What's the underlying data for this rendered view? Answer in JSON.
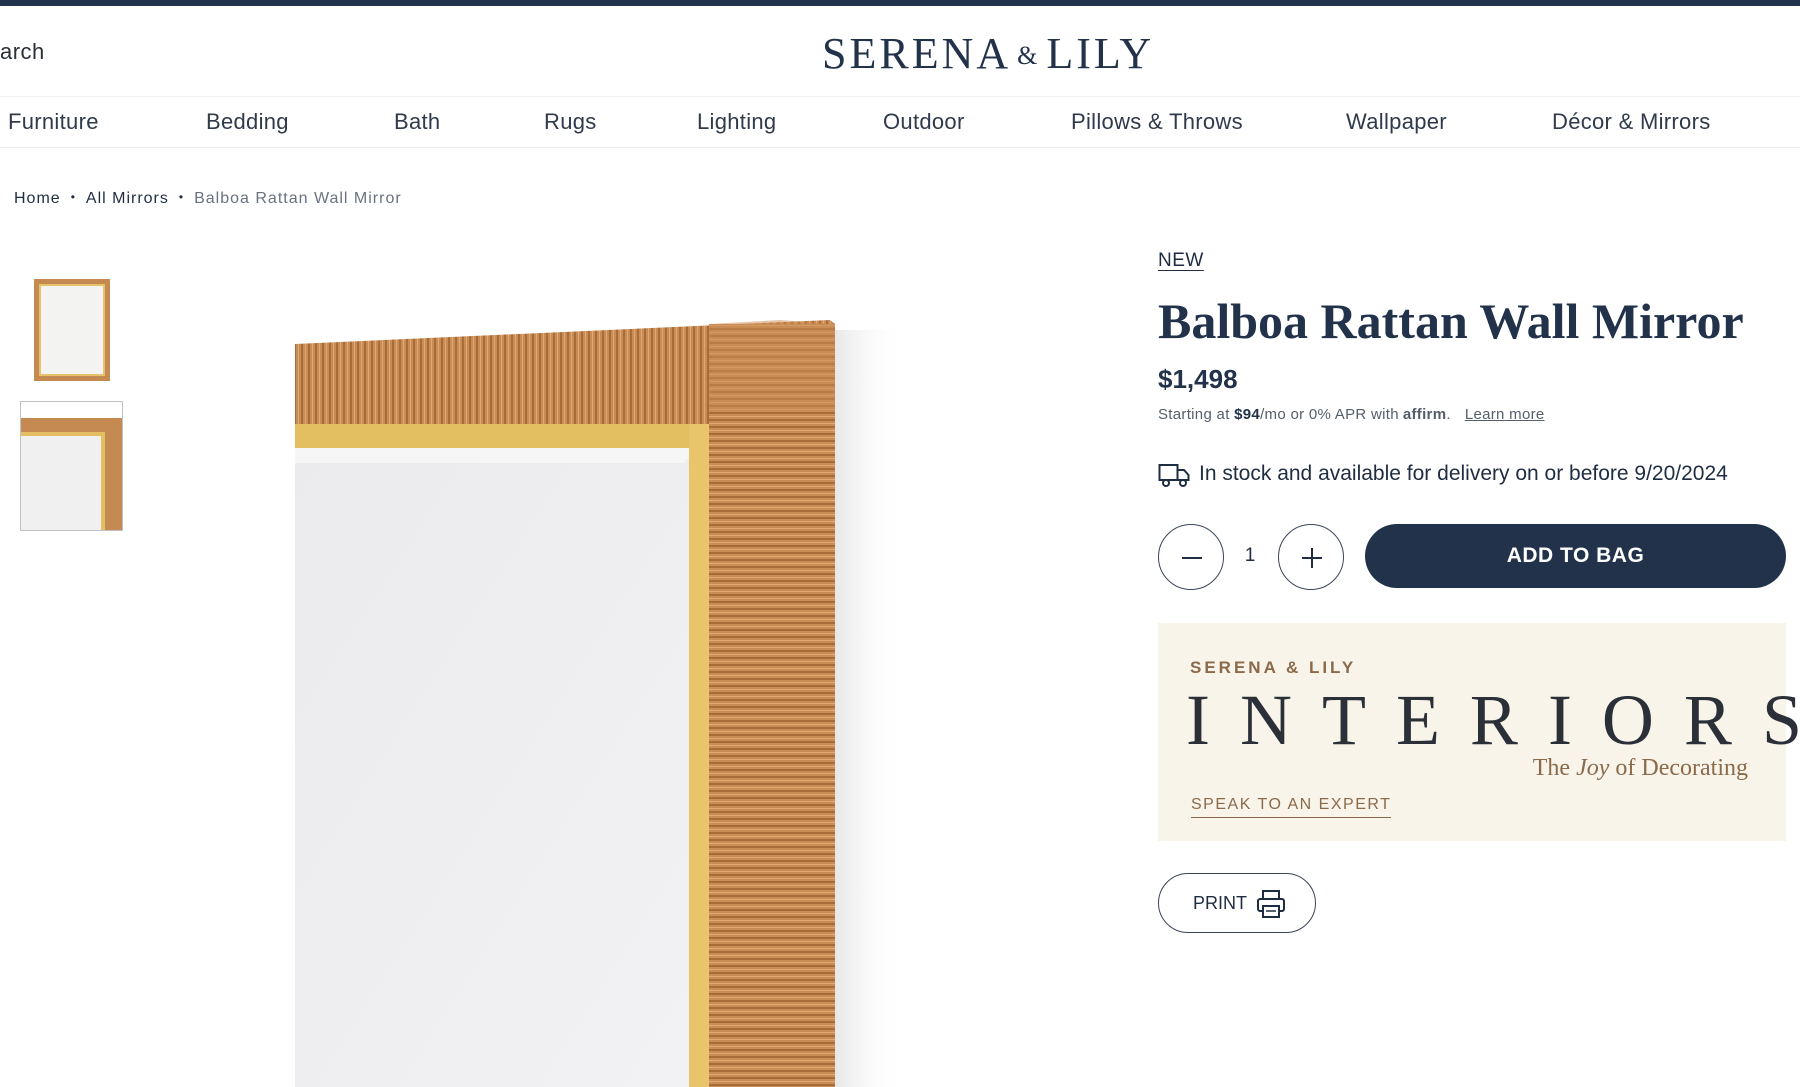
{
  "header": {
    "search_text": "arch",
    "logo": {
      "left": "SERENA",
      "amp": "&",
      "right": "LILY"
    }
  },
  "nav": {
    "items": [
      "Furniture",
      "Bedding",
      "Bath",
      "Rugs",
      "Lighting",
      "Outdoor",
      "Pillows & Throws",
      "Wallpaper",
      "Décor & Mirrors"
    ]
  },
  "breadcrumb": {
    "items": [
      "Home",
      "All Mirrors",
      "Balboa Rattan Wall Mirror"
    ],
    "separator": "•"
  },
  "product": {
    "badge": "NEW",
    "title": "Balboa Rattan Wall Mirror",
    "price": "$1,498",
    "financing": {
      "prefix": "Starting at ",
      "monthly": "$94",
      "suffix": "/mo or 0% APR with",
      "provider": "affirm",
      "learn_more": "Learn more"
    },
    "delivery": "In stock and available for delivery on or before 9/20/2024",
    "quantity": "1",
    "add_to_bag": "ADD TO BAG",
    "print": "PRINT"
  },
  "interiors": {
    "brand": "SERENA & LILY",
    "title": "INTERIORS",
    "tagline_pre": "The ",
    "tagline_em": "Joy",
    "tagline_post": " of Decorating",
    "cta": "SPEAK TO AN EXPERT"
  },
  "colors": {
    "navy": "#21324a",
    "rattan": "#c58a52",
    "brass": "#e3bf62",
    "cream": "#f8f4ea",
    "accent_brown": "#8a6a4b"
  }
}
